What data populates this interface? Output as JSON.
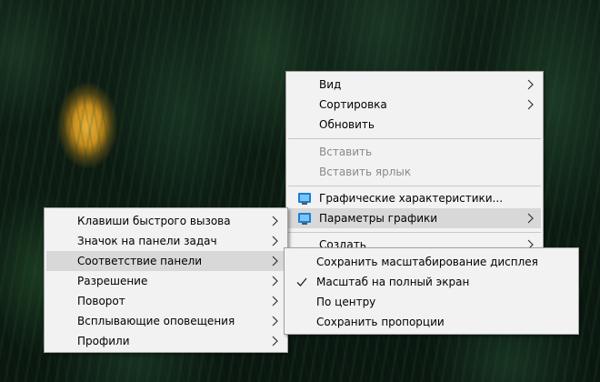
{
  "desktop_menu": {
    "items": [
      {
        "label": "Вид",
        "has_submenu": true,
        "enabled": true
      },
      {
        "label": "Сортировка",
        "has_submenu": true,
        "enabled": true
      },
      {
        "label": "Обновить",
        "has_submenu": false,
        "enabled": true
      },
      {
        "label": "Вставить",
        "has_submenu": false,
        "enabled": false
      },
      {
        "label": "Вставить ярлык",
        "has_submenu": false,
        "enabled": false
      },
      {
        "label": "Графические характеристики...",
        "icon": "intel-graphics-icon",
        "enabled": true
      },
      {
        "label": "Параметры графики",
        "icon": "intel-graphics-icon",
        "has_submenu": true,
        "enabled": true,
        "highlighted": true
      },
      {
        "label": "Создать",
        "has_submenu": true,
        "enabled": true
      }
    ]
  },
  "panel_menu": {
    "items": [
      {
        "label": "Клавиши быстрого вызова",
        "has_submenu": true
      },
      {
        "label": "Значок на панели задач",
        "has_submenu": true
      },
      {
        "label": "Соответствие панели",
        "has_submenu": true,
        "highlighted": true
      },
      {
        "label": "Разрешение",
        "has_submenu": true
      },
      {
        "label": "Поворот",
        "has_submenu": true
      },
      {
        "label": "Всплывающие оповещения",
        "has_submenu": true
      },
      {
        "label": "Профили",
        "has_submenu": true
      }
    ]
  },
  "fit_menu": {
    "items": [
      {
        "label": "Сохранить масштабирование дисплея",
        "checked": false
      },
      {
        "label": "Масштаб на полный экран",
        "checked": true
      },
      {
        "label": "По центру",
        "checked": false
      },
      {
        "label": "Сохранить пропорции",
        "checked": false
      }
    ]
  },
  "colors": {
    "menu_bg": "#f2f2f2",
    "highlight": "#d8d8d8",
    "disabled_text": "#8a8a8a",
    "intel_blue": "#1a7fd6"
  }
}
